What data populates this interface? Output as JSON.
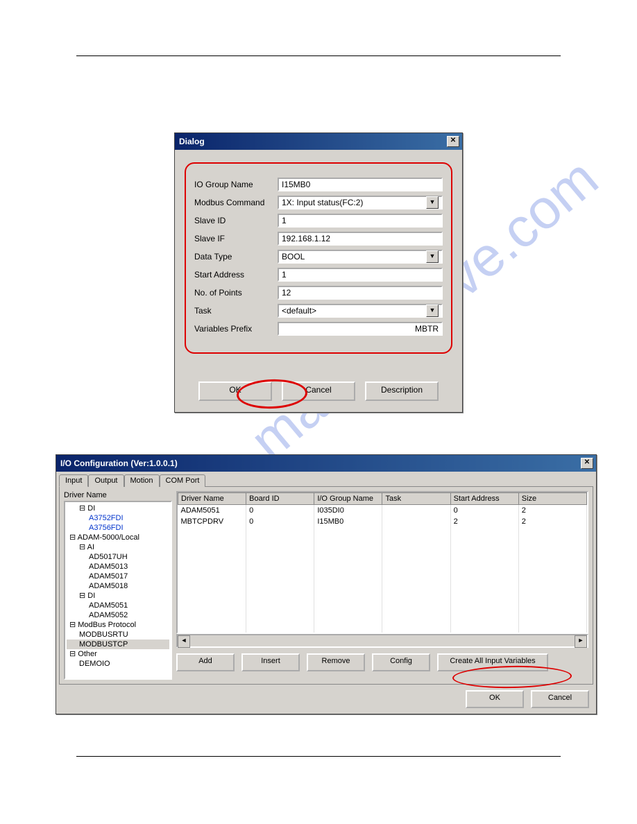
{
  "dialog1": {
    "title": "Dialog",
    "fields": {
      "io_group_name": {
        "label": "IO Group Name",
        "value": "I15MB0"
      },
      "modbus_command": {
        "label": "Modbus Command",
        "value": "1X: Input status(FC:2)"
      },
      "slave_id": {
        "label": "Slave ID",
        "value": "1"
      },
      "slave_if": {
        "label": "Slave IF",
        "value": "192.168.1.12"
      },
      "data_type": {
        "label": "Data Type",
        "value": "BOOL"
      },
      "start_address": {
        "label": "Start Address",
        "value": "1"
      },
      "no_of_points": {
        "label": "No. of Points",
        "value": "12"
      },
      "task": {
        "label": "Task",
        "value": "<default>"
      },
      "variables_prefix": {
        "label": "Variables Prefix",
        "value": "MBTR"
      }
    },
    "buttons": {
      "ok": "OK",
      "cancel": "Cancel",
      "description": "Description"
    }
  },
  "dialog2": {
    "title": "I/O Configuration (Ver:1.0.0.1)",
    "tabs": [
      "Input",
      "Output",
      "Motion",
      "COM Port"
    ],
    "active_tab": "Input",
    "driver_name_label": "Driver Name",
    "tree": [
      {
        "lvl": 1,
        "txt": "DI",
        "exp": "-"
      },
      {
        "lvl": 2,
        "txt": "A3752FDI",
        "cls": "blue"
      },
      {
        "lvl": 2,
        "txt": "A3756FDI",
        "cls": "blue"
      },
      {
        "lvl": 0,
        "txt": "ADAM-5000/Local",
        "exp": "-"
      },
      {
        "lvl": 1,
        "txt": "AI",
        "exp": "-"
      },
      {
        "lvl": 2,
        "txt": "AD5017UH"
      },
      {
        "lvl": 2,
        "txt": "ADAM5013"
      },
      {
        "lvl": 2,
        "txt": "ADAM5017"
      },
      {
        "lvl": 2,
        "txt": "ADAM5018"
      },
      {
        "lvl": 1,
        "txt": "DI",
        "exp": "-"
      },
      {
        "lvl": 2,
        "txt": "ADAM5051"
      },
      {
        "lvl": 2,
        "txt": "ADAM5052"
      },
      {
        "lvl": 0,
        "txt": "ModBus Protocol",
        "exp": "-"
      },
      {
        "lvl": 1,
        "txt": "MODBUSRTU"
      },
      {
        "lvl": 1,
        "txt": "MODBUSTCP",
        "cls": "sel"
      },
      {
        "lvl": 0,
        "txt": "Other",
        "exp": "-"
      },
      {
        "lvl": 1,
        "txt": "DEMOIO"
      }
    ],
    "grid": {
      "headers": [
        "Driver Name",
        "Board ID",
        "I/O Group Name",
        "Task",
        "Start Address",
        "Size"
      ],
      "rows": [
        [
          "ADAM5051",
          "0",
          "I035DI0",
          "",
          "0",
          "2"
        ],
        [
          "MBTCPDRV",
          "0",
          "I15MB0",
          "",
          "2",
          "2"
        ]
      ]
    },
    "buttons": {
      "add": "Add",
      "insert": "Insert",
      "remove": "Remove",
      "config": "Config",
      "create_all": "Create All Input Variables",
      "ok": "OK",
      "cancel": "Cancel"
    }
  },
  "watermark": "manualshive.com"
}
